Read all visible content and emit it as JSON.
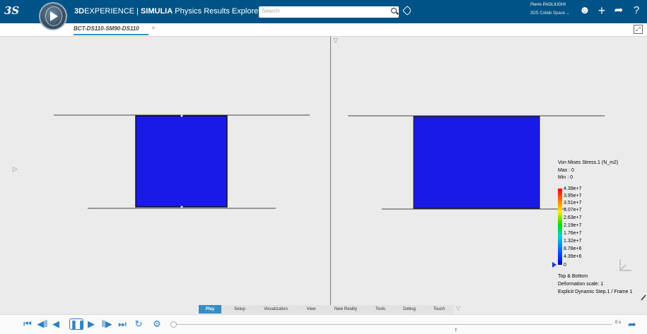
{
  "header": {
    "logo_text": "3S",
    "title_prefix": "3D",
    "title_brand": "EXPERIENCE | ",
    "title_simulia": "SIMULIA",
    "title_app": " Physics Results Explorer",
    "search_placeholder": "Search",
    "user_name": "Pierre PAGLIUGHI",
    "collab_space": "3DS Collab Space",
    "icons": [
      "search-icon",
      "tag-icon",
      "user-icon",
      "add-icon",
      "share-icon",
      "help-icon"
    ]
  },
  "tabs": {
    "active_label": "BCT-DS110-SM90-DS110",
    "add_label": "+"
  },
  "legend": {
    "title": "Von Mises Stress.1 (N_m2)",
    "max": "Max : 0",
    "min": "Min : 0",
    "values": [
      "4.39e+7",
      "3.95e+7",
      "3.51e+7",
      "3.07e+7",
      "2.63e+7",
      "2.19e+7",
      "1.76e+7",
      "1.32e+7",
      "8.78e+6",
      "4.39e+6",
      "0"
    ],
    "footer1": "Top & Bottom",
    "footer2": "Deformation scale: 1",
    "footer3": "Explicit Dynamic Step.1 / Frame 1",
    "colors": [
      "#ff0000",
      "#ff7f00",
      "#ffee00",
      "#00dd00",
      "#00d6d6",
      "#0060ff",
      "#0000cc"
    ]
  },
  "command_tabs": [
    "Play",
    "Setup",
    "Visualization",
    "View",
    "New Reality",
    "Tools",
    "Debug",
    "Touch"
  ],
  "active_command_tab": "Play",
  "player": {
    "time": "0 s",
    "cursor": "T",
    "progress": 0
  },
  "colors": {
    "topbar": "#005386",
    "accent": "#368ec4",
    "model_fill": "#1a1ae6"
  }
}
